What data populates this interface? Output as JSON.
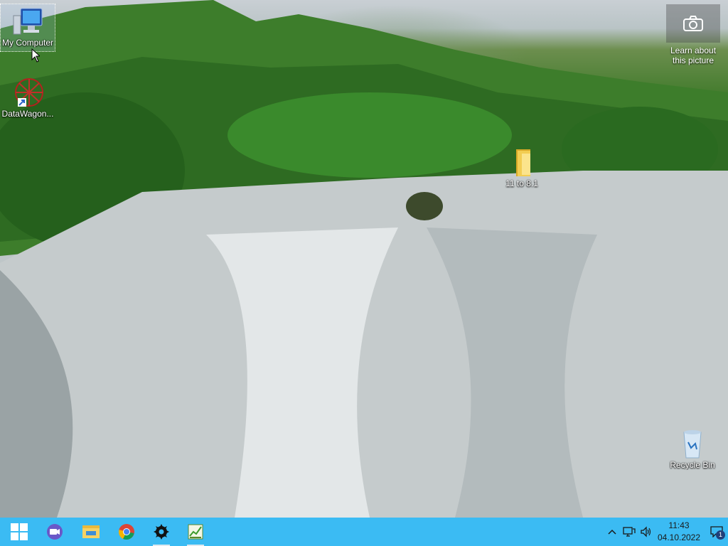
{
  "desktop": {
    "icons": [
      {
        "label": "My Computer",
        "icon": "computer-icon"
      },
      {
        "label": "DataWagon...",
        "icon": "datawagon-icon"
      },
      {
        "label": "11 to 8.1",
        "icon": "folder-icon"
      },
      {
        "label": "Recycle Bin",
        "icon": "recycle-bin-icon"
      }
    ],
    "learn_label": "Learn about this picture"
  },
  "taskbar": {
    "apps": [
      "start-icon",
      "meet-icon",
      "file-explorer-icon",
      "chrome-icon",
      "settings-icon",
      "task-manager-icon"
    ],
    "clock_time": "11:43",
    "clock_date": "04.10.2022",
    "notification_count": "1"
  }
}
